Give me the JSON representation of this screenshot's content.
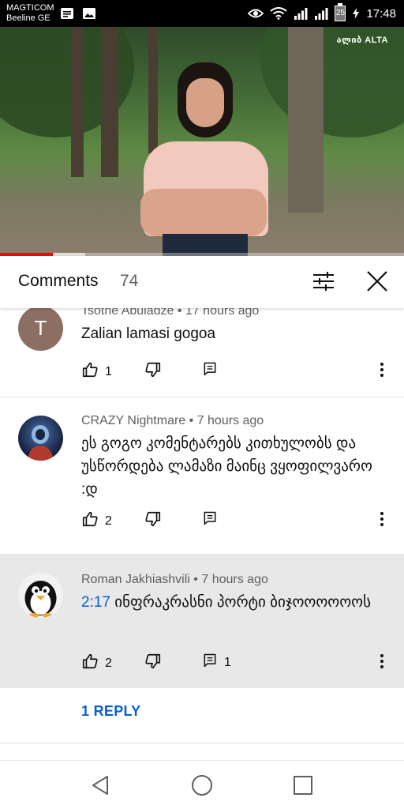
{
  "status_bar": {
    "carrier_line1": "MAGTICOM",
    "carrier_line2": "Beeline GE",
    "battery_level": "25",
    "time": "17:48"
  },
  "video": {
    "watermark": "ალიბ ALTA",
    "progress_percent": 13,
    "buffered_percent": 21
  },
  "comments_panel": {
    "title": "Comments",
    "count": "74"
  },
  "comments": [
    {
      "author": "Tsotne Abuladze",
      "time": "17 hours ago",
      "avatar_letter": "T",
      "avatar_color": "#8d6e63",
      "text": "Zalian lamasi gogoa",
      "likes": "1"
    },
    {
      "author": "CRAZY Nightmare",
      "time": "7 hours ago",
      "text": "ეს გოგო კომენტარებს კითხულობს და უსწორდება ლამაზი მაინც ვყოფილვარო :დ",
      "likes": "2"
    },
    {
      "author": "Roman Jakhiashvili",
      "time": "7 hours ago",
      "timestamp": "2:17",
      "text": "ინფრაკრასნი პორტი ბიჯოოოოოოს",
      "likes": "2",
      "replies": "1",
      "reply_link": "1 REPLY"
    }
  ],
  "colors": {
    "link_blue": "#065fd4",
    "highlight_bg": "#e8e8e8",
    "progress_red": "#ff0000"
  }
}
